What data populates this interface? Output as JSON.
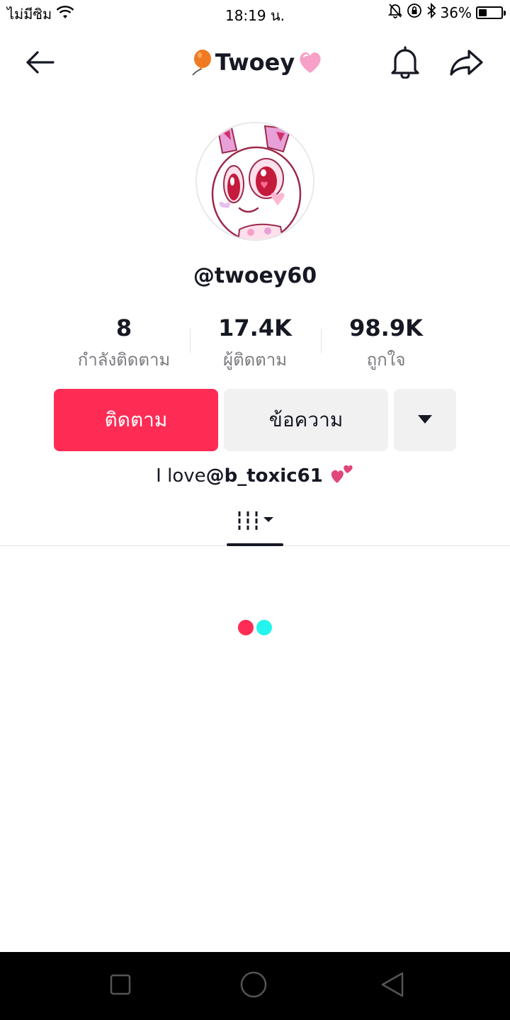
{
  "status_bar": {
    "carrier": "ไม่มีซิม",
    "time": "18:19 น.",
    "battery_percent": "36%",
    "battery_level": 0.36,
    "icons": [
      "wifi-icon",
      "mute-icon",
      "rotation-lock-icon",
      "bluetooth-icon",
      "battery-icon"
    ]
  },
  "header": {
    "title": "Twoey",
    "title_prefix_emoji": "balloon",
    "title_suffix_emoji": "pink-heart",
    "icons": [
      "back-arrow-icon",
      "bell-icon",
      "share-icon"
    ]
  },
  "profile": {
    "username": "@twoey60",
    "stats": [
      {
        "value": "8",
        "label": "กำลังติดตาม"
      },
      {
        "value": "17.4K",
        "label": "ผู้ติดตาม"
      },
      {
        "value": "98.9K",
        "label": "ถูกใจ"
      }
    ]
  },
  "actions": {
    "follow_label": "ติดตาม",
    "message_label": "ข้อความ",
    "more_icon": "caret-down-icon"
  },
  "bio": {
    "text": "I love",
    "mention": "@b_toxic61",
    "emoji": "two-hearts"
  },
  "tabs": {
    "active_icon": "grid-icon"
  },
  "colors": {
    "accent": "#fe2c55",
    "secondary_button": "#f1f1f2",
    "loader_red": "#fe2c55",
    "loader_cyan": "#25f4ee",
    "muted_text": "#7b7b80"
  }
}
